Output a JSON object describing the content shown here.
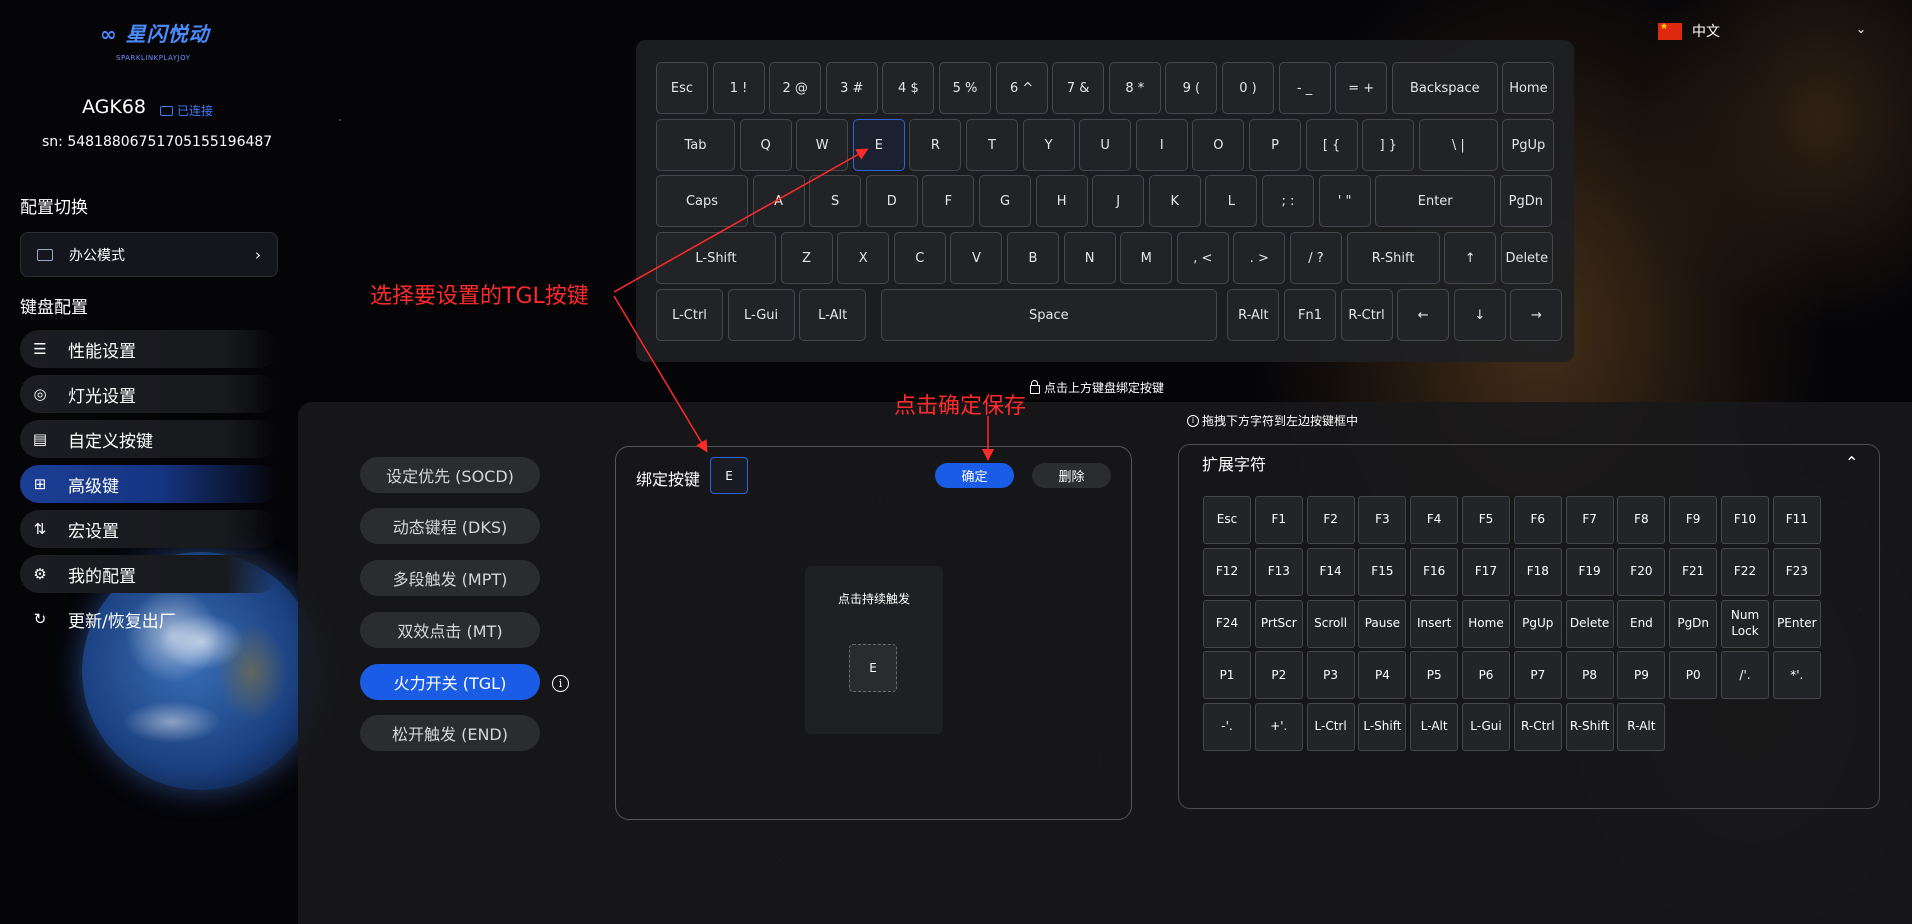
{
  "app": {
    "logo_text": "星闪悦动",
    "logo_sub": "SPARKLINKPLAYJOY"
  },
  "device": {
    "name": "AGK68",
    "status": "已连接",
    "sn": "sn: 5481880675170515519648​7"
  },
  "sidebar": {
    "config_switch_title": "配置切换",
    "mode": "办公模式",
    "keyboard_config_title": "键盘配置",
    "items": [
      {
        "label": "性能设置",
        "icon": "sliders-icon"
      },
      {
        "label": "灯光设置",
        "icon": "bulb-icon"
      },
      {
        "label": "自定义按键",
        "icon": "keyboard-icon"
      },
      {
        "label": "高级键",
        "icon": "grid-icon"
      },
      {
        "label": "宏设置",
        "icon": "macro-icon"
      },
      {
        "label": "我的配置",
        "icon": "gear-icon"
      },
      {
        "label": "更新/恢复出厂",
        "icon": "refresh-icon"
      }
    ]
  },
  "language": {
    "label": "中文"
  },
  "keyboard": {
    "rows": [
      [
        "Esc",
        "1 !",
        "2 @",
        "3 #",
        "4 $",
        "5 %",
        "6 ^",
        "7 &",
        "8 *",
        "9 (",
        "0 )",
        "- _",
        "= +",
        "Backspace",
        "Home"
      ],
      [
        "Tab",
        "Q",
        "W",
        "E",
        "R",
        "T",
        "Y",
        "U",
        "I",
        "O",
        "P",
        "[ {",
        "] }",
        "\\ |",
        "PgUp"
      ],
      [
        "Caps",
        "A",
        "S",
        "D",
        "F",
        "G",
        "H",
        "J",
        "K",
        "L",
        "; :",
        "' \"",
        "Enter",
        "PgDn"
      ],
      [
        "L-Shift",
        "Z",
        "X",
        "C",
        "V",
        "B",
        "N",
        "M",
        ", <",
        ". >",
        "/ ?",
        "R-Shift",
        "↑",
        "Delete"
      ],
      [
        "L-Ctrl",
        "L-Gui",
        "L-Alt",
        "Space",
        "R-Alt",
        "Fn1",
        "R-Ctrl",
        "←",
        "↓",
        "→"
      ]
    ],
    "selected_key": "E",
    "hint": "点击上方键盘绑定按键"
  },
  "advanced": {
    "modes": [
      "设定优先 (SOCD)",
      "动态键程 (DKS)",
      "多段触发 (MPT)",
      "双效点击 (MT)",
      "火力开关 (TGL)",
      "松开触发 (END)"
    ],
    "active_index": 4,
    "bind_label": "绑定按键",
    "bind_key": "E",
    "confirm": "确定",
    "delete": "删除",
    "hold_title": "点击持续触发",
    "hold_key": "E"
  },
  "extended": {
    "hint": "拖拽下方字符到左边按键框中",
    "title": "扩展字符",
    "keys": [
      [
        "Esc",
        "F1",
        "F2",
        "F3",
        "F4",
        "F5",
        "F6",
        "F7",
        "F8",
        "F9",
        "F10",
        "F11"
      ],
      [
        "F12",
        "F13",
        "F14",
        "F15",
        "F16",
        "F17",
        "F18",
        "F19",
        "F20",
        "F21",
        "F22",
        "F23"
      ],
      [
        "F24",
        "PrtScr",
        "Scroll",
        "Pause",
        "Insert",
        "Home",
        "PgUp",
        "Delete",
        "End",
        "PgDn",
        "Num Lock",
        "PEnter"
      ],
      [
        "P1",
        "P2",
        "P3",
        "P4",
        "P5",
        "P6",
        "P7",
        "P8",
        "P9",
        "P0",
        "/'.",
        "*'."
      ],
      [
        "-'.",
        "+'.",
        "L-Ctrl",
        "L-Shift",
        "L-Alt",
        "L-Gui",
        "R-Ctrl",
        "R-Shift",
        "R-Alt"
      ]
    ]
  },
  "annotations": {
    "select_key": "选择要设置的TGL按键",
    "click_confirm": "点击确定保存"
  },
  "colors": {
    "accent": "#1a5ce6",
    "annotation": "#ff2a2a"
  }
}
